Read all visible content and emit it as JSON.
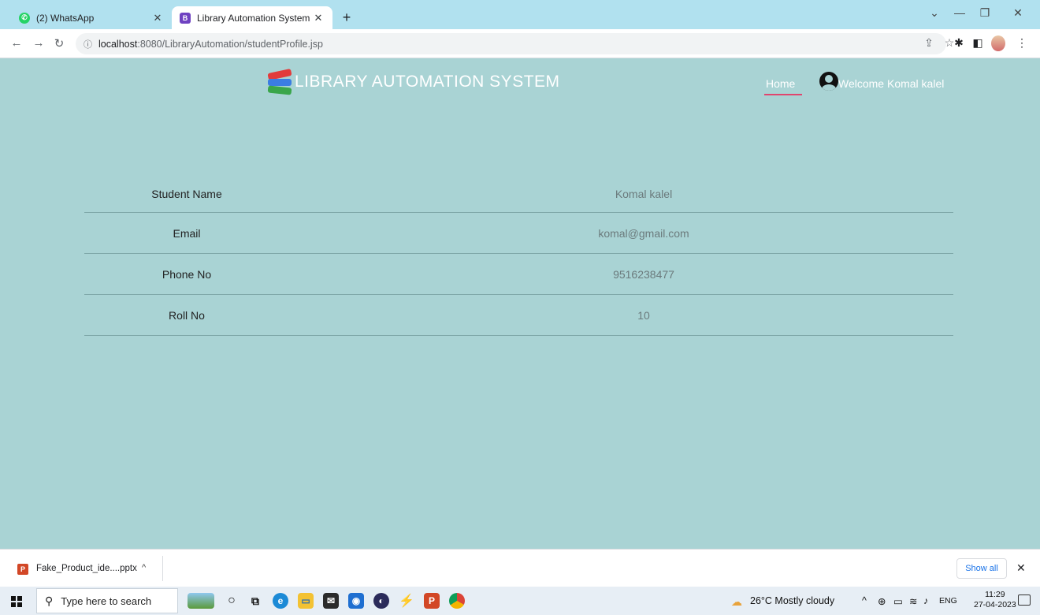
{
  "browser": {
    "tabs": [
      {
        "title": "(2) WhatsApp",
        "favicon": "whatsapp-icon",
        "active": false
      },
      {
        "title": "Library Automation System",
        "favicon": "bootstrap-icon",
        "active": true
      }
    ],
    "new_tab_label": "+",
    "address": {
      "host": "localhost",
      "path": ":8080/LibraryAutomation/studentProfile.jsp"
    }
  },
  "page": {
    "brand_title": "LIBRARY AUTOMATION SYSTEM",
    "nav": {
      "home": "Home",
      "welcome": "Welcome Komal kalel"
    },
    "profile": [
      {
        "label": "Student Name",
        "value": "Komal kalel"
      },
      {
        "label": "Email",
        "value": "komal@gmail.com"
      },
      {
        "label": "Phone No",
        "value": "9516238477"
      },
      {
        "label": "Roll No",
        "value": "10"
      }
    ],
    "colors": {
      "background": "#a9d3d4",
      "active_nav_underline": "#e0456e"
    }
  },
  "download_bar": {
    "file_name": "Fake_Product_ide....pptx",
    "show_all": "Show all"
  },
  "taskbar": {
    "search_placeholder": "Type here to search",
    "weather": "26°C  Mostly cloudy",
    "language": "ENG",
    "time": "11:29",
    "date": "27-04-2023"
  }
}
